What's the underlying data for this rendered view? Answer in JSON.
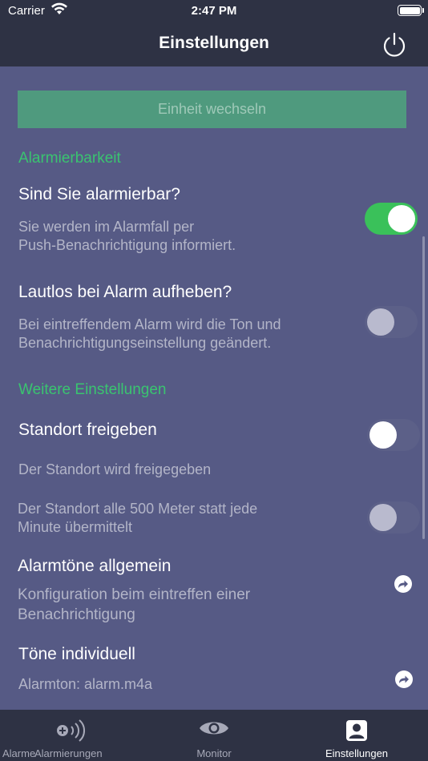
{
  "status_bar": {
    "carrier": "Carrier",
    "time": "2:47 PM",
    "wifi_icon": "wifi-icon",
    "battery_icon": "battery-icon"
  },
  "nav": {
    "title": "Einstellungen",
    "power_icon": "power-icon"
  },
  "switch_unit": {
    "label": "Einheit wechseln"
  },
  "sections": {
    "alarmierbarkeit": "Alarmierbarkeit",
    "weitere": "Weitere Einstellungen"
  },
  "rows": {
    "alarmierbar": {
      "title": "Sind Sie alarmierbar?",
      "desc_1": "Sie werden im Alarmfall per",
      "desc_2": "Push-Benachrichtigung informiert.",
      "enabled": true
    },
    "lautlos": {
      "title": "Lautlos bei Alarm aufheben?",
      "desc_1": "Bei eintreffendem Alarm wird die Ton und",
      "desc_2": "Benachrichtigungseinstellung geändert.",
      "enabled": false
    },
    "standort": {
      "title": "Standort freigeben",
      "desc": "Der Standort wird freigegeben",
      "enabled": false
    },
    "standort_500": {
      "desc_1": "Der Standort alle 500 Meter statt jede",
      "desc_2": "Minute übermittelt",
      "enabled": false
    },
    "alarmtoene": {
      "title": "Alarmtöne allgemein",
      "desc_1": "Konfiguration beim eintreffen einer",
      "desc_2": "Benachrichtigung",
      "icon": "forward-arrow-icon"
    },
    "toene_individuell": {
      "title": "Töne individuell",
      "desc": "Alarmton: alarm.m4a",
      "icon": "forward-arrow-icon"
    }
  },
  "tabbar": {
    "tabs": [
      {
        "label_a": "Alarmierungen",
        "label_b": "Alarme",
        "icon": "alarm-broadcast-icon",
        "active": false
      },
      {
        "label": "Monitor",
        "icon": "eye-icon",
        "active": false
      },
      {
        "label": "Einstellungen",
        "icon": "person-card-icon",
        "active": true
      }
    ]
  },
  "colors": {
    "background": "#565a85",
    "header": "#2e3244",
    "accent_green": "#3ac470",
    "toggle_on": "#3ac15a",
    "button_green": "#4f9a7e"
  }
}
